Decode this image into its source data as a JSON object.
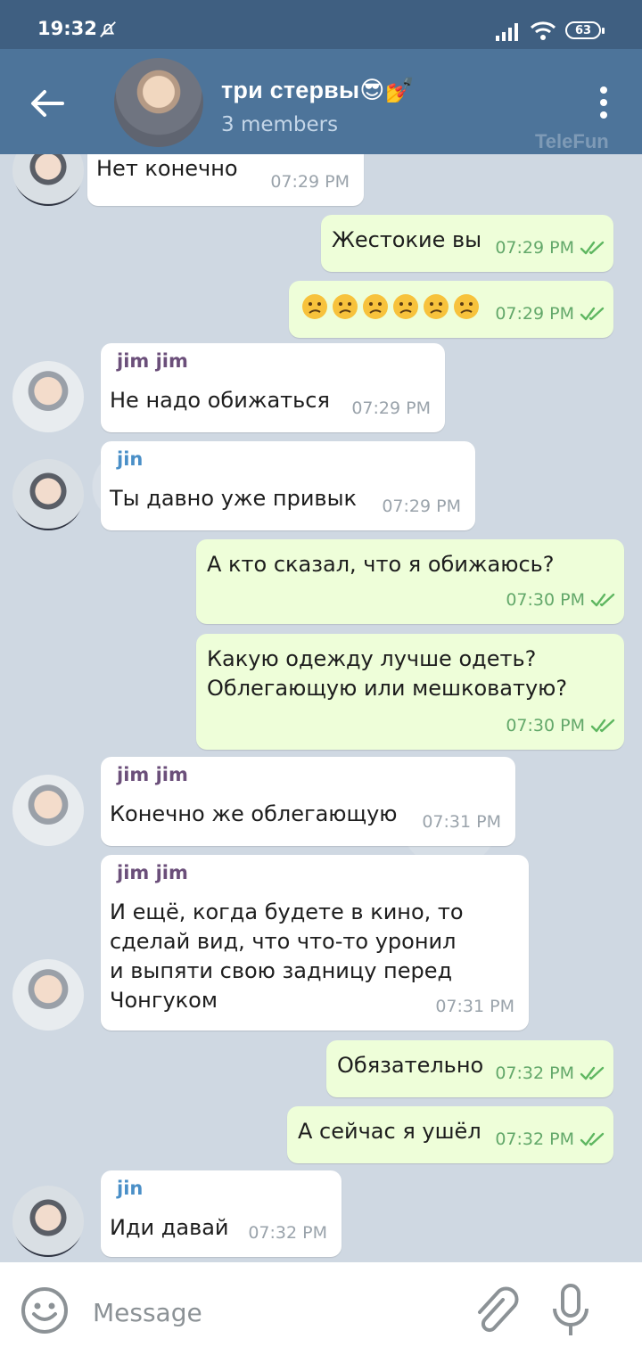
{
  "status_bar": {
    "time": "19:32",
    "battery": "63"
  },
  "header": {
    "title": "три стервы😎💅",
    "subtitle": "3 members",
    "watermark": "TeleFun"
  },
  "messages": [
    {
      "direction": "in",
      "sender": "",
      "text": "Нет конечно",
      "time": "07:29 PM",
      "avatar": "jin"
    },
    {
      "direction": "out",
      "text": "Жестокие вы",
      "time": "07:29 PM"
    },
    {
      "direction": "out",
      "text": "😕😕😕😕😕😕",
      "time": "07:29 PM"
    },
    {
      "direction": "in",
      "sender": "jim jim",
      "text": "Не надо обижаться",
      "time": "07:29 PM",
      "avatar": "jim"
    },
    {
      "direction": "in",
      "sender": "jin",
      "text": "Ты давно уже привык",
      "time": "07:29 PM",
      "avatar": "jin"
    },
    {
      "direction": "out",
      "text": "А кто сказал, что я обижаюсь?",
      "time": "07:30 PM"
    },
    {
      "direction": "out",
      "text": "Какую одежду лучше одеть?\nОблегающую или мешковатую?",
      "time": "07:30 PM"
    },
    {
      "direction": "in",
      "sender": "jim jim",
      "text": "Конечно же облегающую",
      "time": "07:31 PM",
      "avatar": "jim"
    },
    {
      "direction": "in",
      "sender": "jim jim",
      "text": "И ещё, когда будете в кино, то\nсделай вид, что что-то уронил\nи выпяти свою задницу перед\nЧонгуком",
      "time": "07:31 PM",
      "avatar": "jim"
    },
    {
      "direction": "out",
      "text": "Обязательно",
      "time": "07:32 PM"
    },
    {
      "direction": "out",
      "text": "А сейчас я ушёл",
      "time": "07:32 PM"
    },
    {
      "direction": "in",
      "sender": "jin",
      "text": "Иди давай",
      "time": "07:32 PM",
      "avatar": "jin"
    }
  ],
  "input": {
    "placeholder": "Message"
  },
  "colors": {
    "header": "#4d749a",
    "status_bar": "#3f5f81",
    "incoming_bubble": "#ffffff",
    "outgoing_bubble": "#eefed9",
    "sender_jim": "#6b4f7a",
    "sender_jin": "#4a8fc7",
    "outgoing_time": "#63a86a",
    "read_checks": "#5fb761"
  },
  "icons": [
    "mute-bell-icon",
    "signal-icon",
    "wifi-icon",
    "back-arrow-icon",
    "more-vert-icon",
    "emoji-icon",
    "attach-icon",
    "mic-icon",
    "double-check-icon"
  ]
}
